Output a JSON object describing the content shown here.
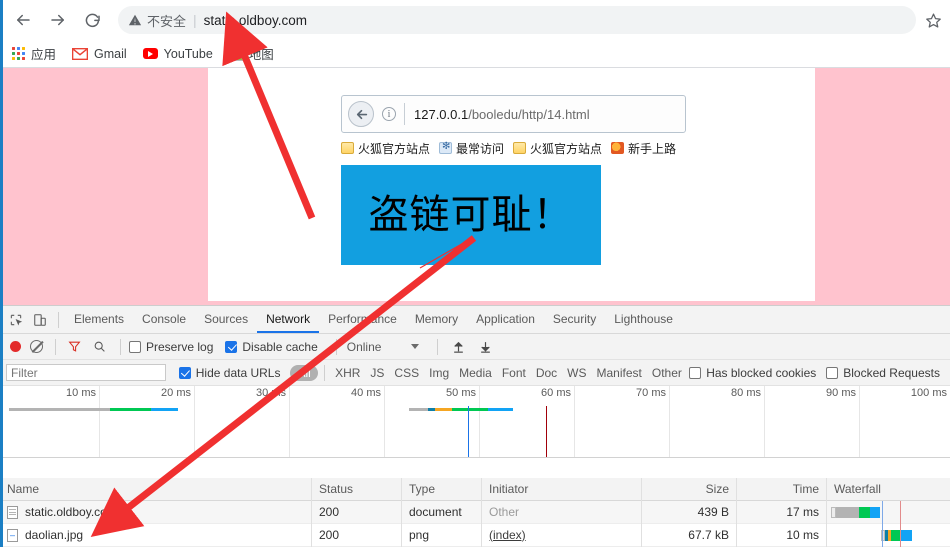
{
  "browser": {
    "nav": {
      "back_icon": "arrow-left-icon",
      "forward_icon": "arrow-right-icon",
      "reload_icon": "reload-icon"
    },
    "omnibox": {
      "security_icon": "warning-triangle-icon",
      "security_label": "不安全",
      "url": "static.oldboy.com",
      "bookmark_icon": "star-icon"
    },
    "bookmarks": [
      {
        "label": "应用",
        "icon": "apps-grid-icon"
      },
      {
        "label": "Gmail",
        "icon": "gmail-icon"
      },
      {
        "label": "YouTube",
        "icon": "youtube-icon"
      },
      {
        "label": "地图",
        "icon": "maps-icon"
      }
    ]
  },
  "page": {
    "background_color": "#ffc3ce",
    "content_background": "#ffffff",
    "embedded_screenshot": {
      "firefox": {
        "back_icon": "back-circle-icon",
        "info_icon": "info-icon",
        "url_host": "127.0.0.1",
        "url_path": "/booledu/http/14.html",
        "bookmarks": [
          {
            "label": "火狐官方站点",
            "icon": "folder-icon"
          },
          {
            "label": "最常访问",
            "icon": "bookmark-star-icon"
          },
          {
            "label": "火狐官方站点",
            "icon": "folder-icon"
          },
          {
            "label": "新手上路",
            "icon": "firefox-icon"
          }
        ],
        "banner": {
          "text": "盗链可耻！",
          "background_color": "#129fe0",
          "text_color": "#000000"
        }
      }
    }
  },
  "devtools": {
    "left_icons": [
      {
        "name": "inspect-element-icon"
      },
      {
        "name": "device-toolbar-icon"
      }
    ],
    "tabs": [
      {
        "label": "Elements",
        "active": false
      },
      {
        "label": "Console",
        "active": false
      },
      {
        "label": "Sources",
        "active": false
      },
      {
        "label": "Network",
        "active": true
      },
      {
        "label": "Performance",
        "active": false
      },
      {
        "label": "Memory",
        "active": false
      },
      {
        "label": "Application",
        "active": false
      },
      {
        "label": "Security",
        "active": false
      },
      {
        "label": "Lighthouse",
        "active": false
      }
    ],
    "toolbar": {
      "record_icon": "record-dot-icon",
      "clear_icon": "clear-icon",
      "filter_icon": "funnel-icon",
      "search_icon": "magnifier-icon",
      "preserve_log": {
        "label": "Preserve log",
        "checked": false
      },
      "disable_cache": {
        "label": "Disable cache",
        "checked": true
      },
      "throttling": "Online",
      "throttling_caret": "chevron-down-icon",
      "import_icon": "upload-arrow-icon",
      "export_icon": "download-arrow-icon"
    },
    "filterbar": {
      "filter_placeholder": "Filter",
      "filter_value": "",
      "hide_data_urls": {
        "label": "Hide data URLs",
        "checked": true
      },
      "types": [
        "All",
        "XHR",
        "JS",
        "CSS",
        "Img",
        "Media",
        "Font",
        "Doc",
        "WS",
        "Manifest",
        "Other"
      ],
      "selected_type": "All",
      "has_blocked_cookies": {
        "label": "Has blocked cookies",
        "checked": false
      },
      "blocked_requests": {
        "label": "Blocked Requests",
        "checked": false
      }
    },
    "overview": {
      "ticks": [
        "10 ms",
        "20 ms",
        "30 ms",
        "40 ms",
        "50 ms",
        "60 ms",
        "70 ms",
        "80 ms",
        "90 ms",
        "100 ms"
      ],
      "dom_content_loaded_color": "#1a73e8",
      "load_color": "#a1000a"
    },
    "network_table": {
      "columns": [
        "Name",
        "Status",
        "Type",
        "Initiator",
        "Size",
        "Time",
        "Waterfall"
      ],
      "rows": [
        {
          "name": "static.oldboy.com",
          "icon": "document-icon",
          "status": "200",
          "type": "document",
          "initiator": "Other",
          "initiator_style": "plain",
          "size": "439 B",
          "time": "17 ms"
        },
        {
          "name": "daolian.jpg",
          "icon": "image-icon",
          "status": "200",
          "type": "png",
          "initiator": "(index)",
          "initiator_style": "link",
          "size": "67.7 kB",
          "time": "10 ms"
        }
      ]
    }
  },
  "annotations": {
    "arrow_color": "#f03030",
    "arrows": [
      {
        "name": "arrow-to-url",
        "from": [
          312,
          218
        ],
        "to": [
          232,
          34
        ]
      },
      {
        "name": "arrow-to-file-row",
        "from": [
          472,
          238
        ],
        "to": [
          108,
          522
        ]
      }
    ]
  }
}
